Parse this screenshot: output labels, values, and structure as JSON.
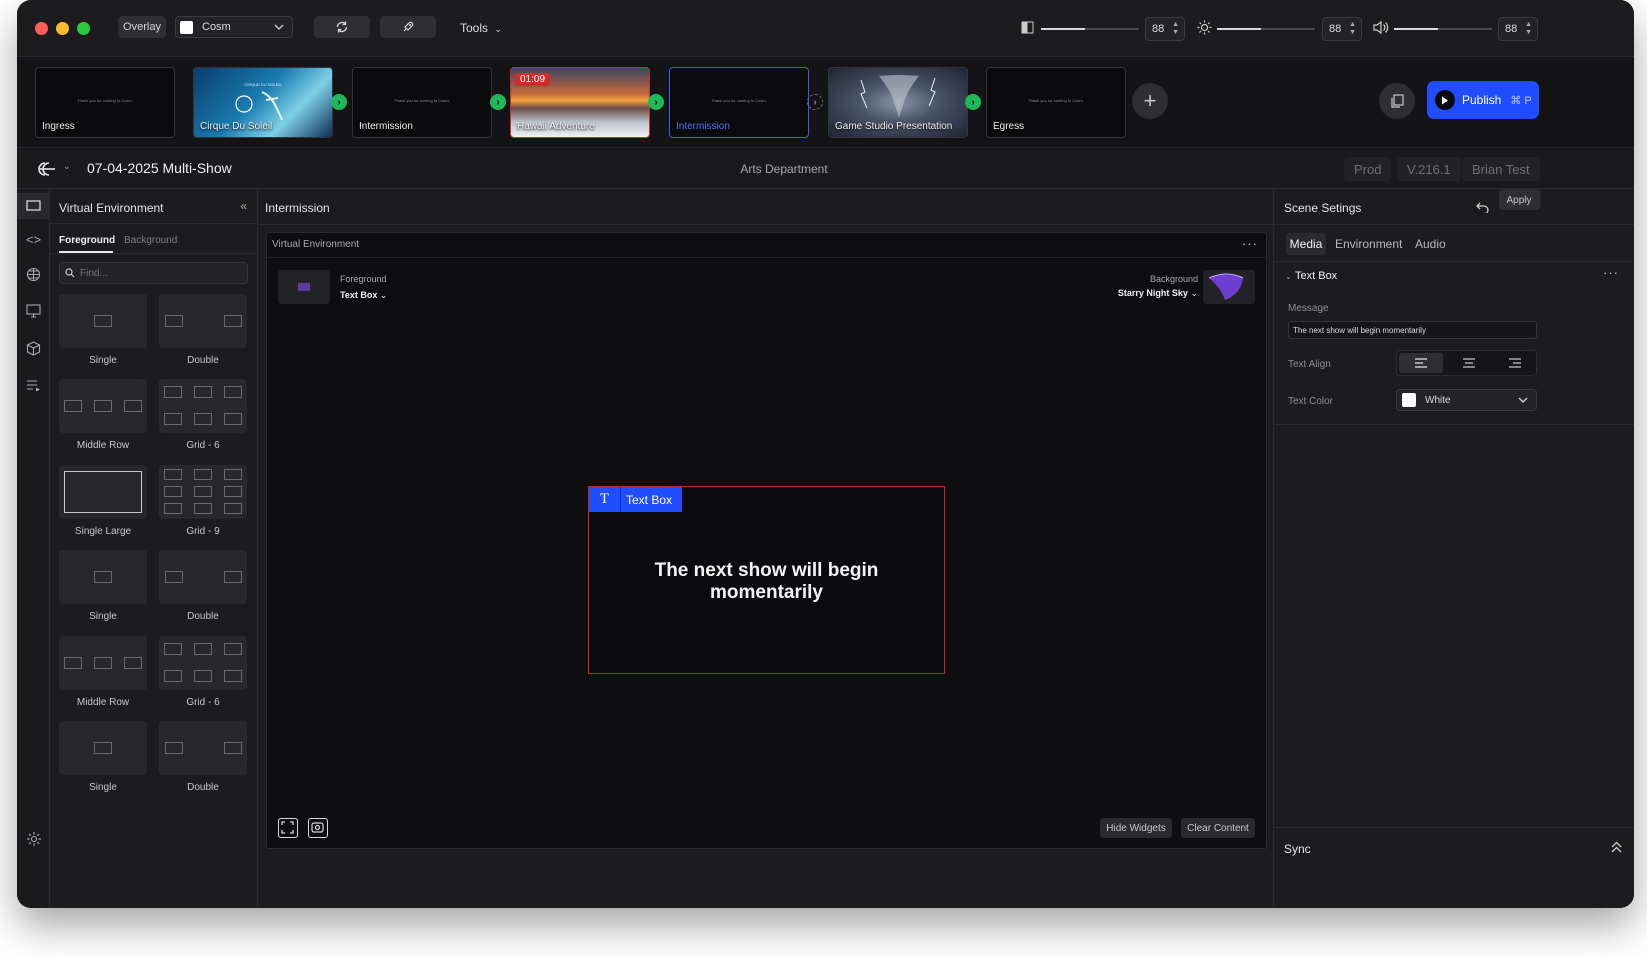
{
  "topbar": {
    "overlay_label": "Overlay",
    "source_select": "Cosm",
    "tools_label": "Tools",
    "contrast_value": "88",
    "brightness_value": "88",
    "volume_value": "88",
    "contrast_level": 0.45,
    "brightness_level": 0.45,
    "volume_level": 0.45
  },
  "scenes": [
    {
      "label": "Ingress",
      "tiny": "Thank you for coming to Cosm."
    },
    {
      "label": "Cirque Du Soleil",
      "tiny": "CIRQUE DU SOLEIL"
    },
    {
      "label": "Intermission",
      "tiny": "Thank you for coming to Cosm."
    },
    {
      "label": "Hawaii Adventure",
      "timer": "01:09"
    },
    {
      "label": "Intermission",
      "tiny": "Thank you for coming to Cosm."
    },
    {
      "label": "Game Studio Presentation"
    },
    {
      "label": "Egress",
      "tiny": "Thank you for coming to Cosm."
    }
  ],
  "publish": {
    "label": "Publish",
    "shortcut": "⌘ P"
  },
  "header": {
    "show_title": "07-04-2025 Multi-Show",
    "department": "Arts Department",
    "env": "Prod",
    "version": "V.216.1",
    "user": "Brian Test"
  },
  "left_panel": {
    "title": "Virtual Environment",
    "tab_foreground": "Foreground",
    "tab_background": "Background",
    "search_placeholder": "Find...",
    "layouts": [
      "Single",
      "Double",
      "Middle Row",
      "Grid - 6",
      "Single Large",
      "Grid - 9",
      "Single",
      "Double",
      "Middle Row",
      "Grid - 6",
      "Single",
      "Double"
    ]
  },
  "center": {
    "title": "Intermission",
    "canvas_label": "Virtual Environment",
    "fg_caption": "Foreground",
    "fg_value": "Text Box",
    "bg_caption": "Background",
    "bg_value": "Starry Night Sky",
    "textbox_tag": "Text Box",
    "textbox_message": "The next show will begin momentarily",
    "hide_widgets": "Hide Widgets",
    "clear_content": "Clear Content"
  },
  "right_panel": {
    "title": "Scene Setings",
    "apply": "Apply",
    "tab_media": "Media",
    "tab_environment": "Environment",
    "tab_audio": "Audio",
    "section": "Text Box",
    "message_label": "Message",
    "message_value": "The next show will begin momentarily",
    "align_label": "Text Align",
    "color_label": "Text Color",
    "color_value": "White",
    "sync": "Sync"
  },
  "colors": {
    "accent": "#1f4dff",
    "live_red": "#d02b2b",
    "go_green": "#1fb85a",
    "selected_blue": "#3a5cff"
  }
}
